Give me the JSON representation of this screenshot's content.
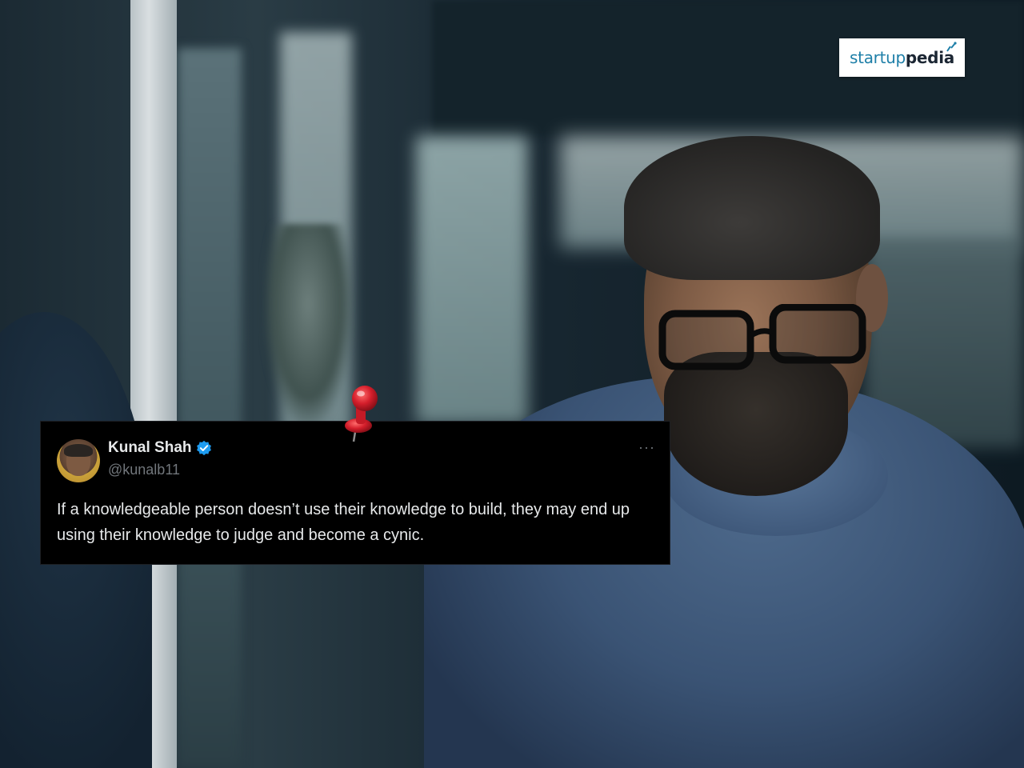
{
  "logo": {
    "text_part_1": "startup",
    "text_part_2": "pedia",
    "brand_color": "#1e7fa8",
    "dark_color": "#1b2633"
  },
  "tweet": {
    "author_name": "Kunal Shah",
    "handle": "@kunalb11",
    "verified": true,
    "more_icon": "more-horizontal-icon",
    "text": "If a knowledgeable person doesn’t use their knowledge to build, they may end up using their knowledge to judge and become a cynic.",
    "background_color": "#000000",
    "text_color": "#e7e9ea",
    "secondary_color": "#71767b",
    "verified_color": "#1d9bf0"
  },
  "decor": {
    "pin_icon": "red-push-pin-icon",
    "pin_color": "#d41e2b"
  }
}
